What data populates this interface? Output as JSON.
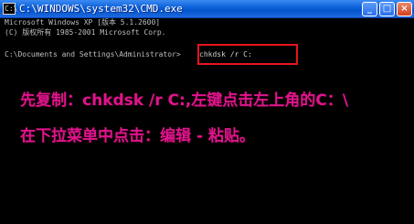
{
  "window": {
    "title": "C:\\WINDOWS\\system32\\CMD.exe",
    "icon_name": "cmd-icon",
    "minimize_icon": "minimize-icon",
    "maximize_icon": "maximize-icon",
    "close_icon": "close-icon"
  },
  "console": {
    "line1": "Microsoft Windows XP [版本 5.1.2600]",
    "line2": "(C) 版权所有 1985-2001 Microsoft Corp.",
    "prompt": "C:\\Documents and Settings\\Administrator>",
    "command": "chkdsk /r C:"
  },
  "annotations": {
    "step1": "先复制：chkdsk /r C:,左键点击左上角的C：\\",
    "step2": "在下拉菜单中点击：编辑 - 粘贴。"
  },
  "colors": {
    "titlebar": "#0a5fd8",
    "console_bg": "#000000",
    "console_text": "#c0c0c0",
    "highlight_box": "#e8141c",
    "annotation_text": "#e0148c"
  }
}
